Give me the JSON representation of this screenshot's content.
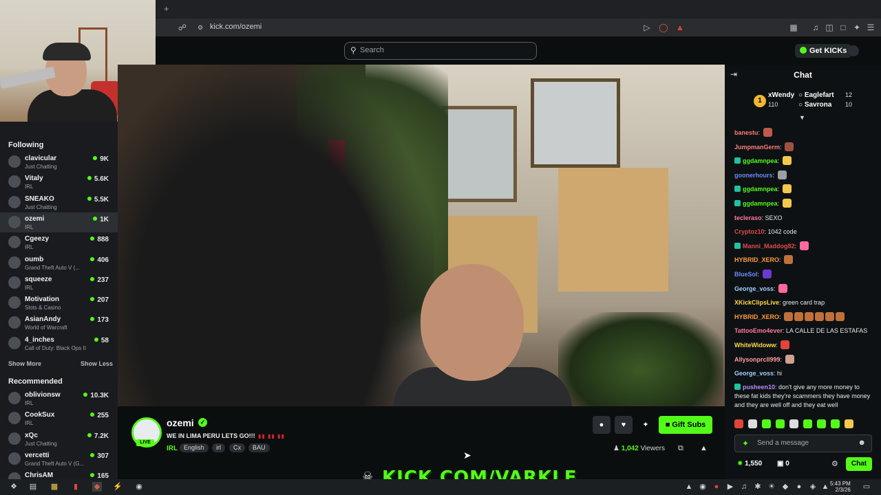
{
  "browser": {
    "new_tab_label": "+",
    "url": "kick.com/ozemi"
  },
  "header": {
    "search_placeholder": "Search",
    "get_kicks_label": "Get KICKs"
  },
  "sidebar": {
    "following_title": "Following",
    "following": [
      {
        "name": "clavicular",
        "category": "Just Chatting",
        "viewers": "9K"
      },
      {
        "name": "Vitaly",
        "category": "IRL",
        "viewers": "5.6K"
      },
      {
        "name": "SNEAKO",
        "category": "Just Chatting",
        "viewers": "5.5K"
      },
      {
        "name": "ozemi",
        "category": "IRL",
        "viewers": "1K"
      },
      {
        "name": "Cgeezy",
        "category": "IRL",
        "viewers": "888"
      },
      {
        "name": "oumb",
        "category": "Grand Theft Auto V (...",
        "viewers": "406"
      },
      {
        "name": "squeeze",
        "category": "IRL",
        "viewers": "237"
      },
      {
        "name": "Motivation",
        "category": "Slots & Casino",
        "viewers": "207"
      },
      {
        "name": "AsianAndy",
        "category": "World of Warcraft",
        "viewers": "173"
      },
      {
        "name": "4_inches",
        "category": "Call of Duty: Black Ops II",
        "viewers": "58"
      }
    ],
    "show_more": "Show More",
    "show_less": "Show Less",
    "recommended_title": "Recommended",
    "recommended": [
      {
        "name": "oblivionsw",
        "category": "IRL",
        "viewers": "10.3K"
      },
      {
        "name": "CookSux",
        "category": "IRL",
        "viewers": "255"
      },
      {
        "name": "xQc",
        "category": "Just Chatting",
        "viewers": "7.2K"
      },
      {
        "name": "vercetti",
        "category": "Grand Theft Auto V (G...",
        "viewers": "307"
      },
      {
        "name": "ChrisAM",
        "category": "",
        "viewers": "165"
      }
    ]
  },
  "stream": {
    "channel": "ozemi",
    "live_badge": "LIVE",
    "title": "WE IN LIMA PERU LETS GO!!!",
    "category": "IRL",
    "tags": [
      "English",
      "irl",
      "Cx",
      "BAU"
    ],
    "gift_subs_label": "Gift Subs",
    "viewers_count": "1,042",
    "viewers_label": "Viewers",
    "watermark": "KICK.COM/VARKLE"
  },
  "chat": {
    "title": "Chat",
    "leaderboard": [
      {
        "name": "xWendy",
        "value": "110"
      },
      {
        "name": "Eaglefart",
        "value": "12"
      },
      {
        "name": "Savrona",
        "value": "10"
      }
    ],
    "messages": [
      {
        "user": "banestu",
        "color": "#ff7a7a",
        "text": ""
      },
      {
        "user": "JumpmanGerm",
        "color": "#ff7a7a",
        "text": ""
      },
      {
        "user": "ggdamnpea",
        "color": "#53fc18",
        "text": ""
      },
      {
        "user": "goonerhours",
        "color": "#6a8cff",
        "text": ""
      },
      {
        "user": "ggdamnpea",
        "color": "#53fc18",
        "text": ""
      },
      {
        "user": "ggdamnpea",
        "color": "#53fc18",
        "text": ""
      },
      {
        "user": "tecleraso",
        "color": "#ff7a9c",
        "text": "SEXO"
      },
      {
        "user": "Cryptoz10",
        "color": "#e04a4a",
        "text": "1042 code"
      },
      {
        "user": "Manni_Maddog82",
        "color": "#e04a4a",
        "text": ""
      },
      {
        "user": "HYBRID_XERO",
        "color": "#ff9c3a",
        "text": ""
      },
      {
        "user": "BlueSol",
        "color": "#6a8cff",
        "text": ""
      },
      {
        "user": "George_voss",
        "color": "#9fd0ff",
        "text": ""
      },
      {
        "user": "XKickClipsLive",
        "color": "#ffd84a",
        "text": "green card trap"
      },
      {
        "user": "HYBRID_XERO",
        "color": "#ff9c3a",
        "text": ""
      },
      {
        "user": "TattooEmo4ever",
        "color": "#ff7a9c",
        "text": "LA CALLE DE LAS ESTAFAS"
      },
      {
        "user": "WhiteWidoww",
        "color": "#ffd84a",
        "text": ""
      },
      {
        "user": "Allysonprcll999",
        "color": "#ff9c9c",
        "text": ""
      },
      {
        "user": "George_voss",
        "color": "#9fd0ff",
        "text": "hi"
      },
      {
        "user": "pusheen10",
        "color": "#b98cff",
        "text": "don't give any more money to these fat kids they're scammers they have money and they are well off and they eat well"
      }
    ],
    "send_placeholder": "Send a message",
    "points": "1,550",
    "gifts": "0",
    "chat_button": "Chat"
  },
  "taskbar": {
    "time": "5:43 PM",
    "date": "2/3/26"
  },
  "colors": {
    "accent": "#53fc18",
    "background": "#0b0e0f",
    "sidebar": "#191b1f"
  }
}
